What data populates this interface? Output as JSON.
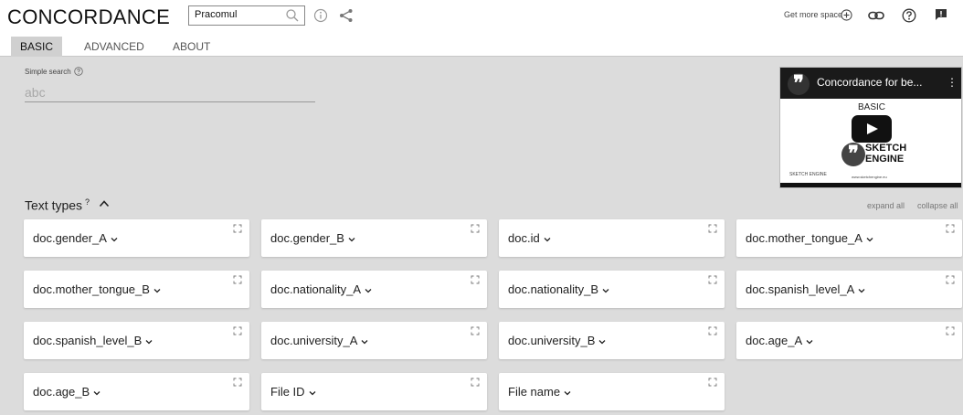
{
  "app": {
    "title": "CONCORDANCE",
    "corpus_name": "Pracomul"
  },
  "header": {
    "get_more_space": "Get more space"
  },
  "tabs": [
    {
      "label": "BASIC",
      "active": true
    },
    {
      "label": "ADVANCED",
      "active": false
    },
    {
      "label": "ABOUT",
      "active": false
    }
  ],
  "search": {
    "label": "Simple search",
    "placeholder": "abc",
    "value": ""
  },
  "video": {
    "title": "Concordance for be...",
    "subtitle": "BASIC",
    "brand_line1": "SKETCH",
    "brand_line2": "ENGINE",
    "small_logo": "SKETCH ENGINE",
    "url": "www.sketchengine.eu"
  },
  "text_types": {
    "title": "Text types",
    "help_mark": "?",
    "expand_all": "expand all",
    "collapse_all": "collapse all",
    "cards": [
      "doc.gender_A",
      "doc.gender_B",
      "doc.id",
      "doc.mother_tongue_A",
      "doc.mother_tongue_B",
      "doc.nationality_A",
      "doc.nationality_B",
      "doc.spanish_level_A",
      "doc.spanish_level_B",
      "doc.university_A",
      "doc.university_B",
      "doc.age_A",
      "doc.age_B",
      "File ID",
      "File name"
    ]
  },
  "colors": {
    "background": "#dcdcdc",
    "header": "#ffffff",
    "active_tab": "#d0d0d0",
    "card": "#ffffff"
  }
}
